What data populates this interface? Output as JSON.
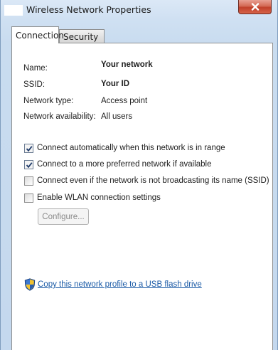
{
  "window": {
    "title": "Wireless Network Properties"
  },
  "tabs": [
    {
      "label": "Connection",
      "selected": true
    },
    {
      "label": "Security",
      "selected": false
    }
  ],
  "info": {
    "name_label": "Name:",
    "name_value": "Your network",
    "ssid_label": "SSID:",
    "ssid_value": "Your ID",
    "type_label": "Network type:",
    "type_value": "Access point",
    "availability_label": "Network availability:",
    "availability_value": "All users"
  },
  "options": [
    {
      "label": "Connect automatically when this network is in range",
      "checked": true
    },
    {
      "label": "Connect to a more preferred network if available",
      "checked": true
    },
    {
      "label": "Connect even if the network is not broadcasting its name (SSID)",
      "checked": false
    },
    {
      "label": "Enable WLAN connection settings",
      "checked": false
    }
  ],
  "configure_button": {
    "label": "Configure...",
    "enabled": false
  },
  "usb_link": {
    "label": "Copy this network profile to a USB flash drive",
    "icon": "uac-shield-icon"
  },
  "colors": {
    "link": "#1a5aa6",
    "close_button": "#c7432c",
    "title_bar": "#cfe0f2"
  }
}
